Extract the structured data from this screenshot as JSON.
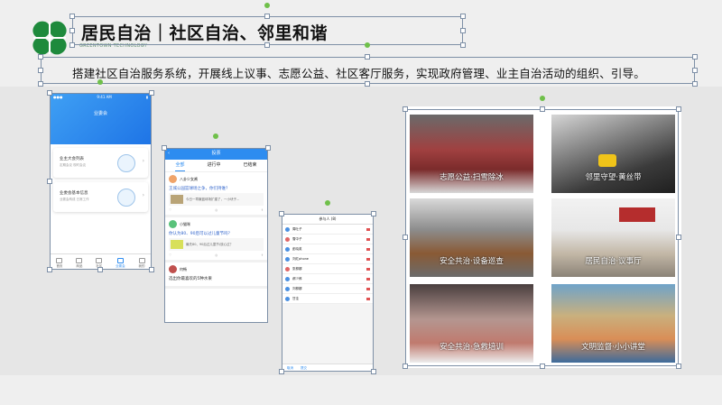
{
  "header": {
    "title": "居民自治｜社区自治、邻里和谐",
    "subtitle": "搭建社区自治服务系统，开展线上议事、志愿公益、社区客厅服务，实现政府管理、业主自治活动的组织、引导。",
    "logo_text": "GREENTOWN TECHNOLOGY",
    "brand_color": "#1e8a3c"
  },
  "phone1": {
    "status_time": "9:41 AM",
    "title": "业委会",
    "cards": [
      {
        "title": "业主大会列表",
        "desc": "定期会议 现时会议"
      },
      {
        "title": "业委会基本信息",
        "desc": "业委会构成 日常工作"
      }
    ],
    "tabs": [
      "首页",
      "商品",
      "社区",
      "业委会",
      "我的"
    ]
  },
  "phone2": {
    "title": "投票",
    "tabs": [
      "全部",
      "进行中",
      "已结束"
    ],
    "posts": [
      {
        "user": "八卦少女酱",
        "text": "王城公园篮球场之争，你们持谁？",
        "snippet": "今日一章篇篮球场扩建了，一小块子..."
      },
      {
        "user": "小猫咪",
        "text": "你认为80、90后可以过儿童节吗？",
        "snippet": "最先80、90后过儿童节/放心过？"
      },
      {
        "user": "何畅",
        "text": "选出你最喜欢的5种水果"
      }
    ]
  },
  "phone3": {
    "title": "参与人 (8)",
    "rows": [
      "周吐子",
      "雪中子",
      "彭晓英",
      "刘红phone",
      "张柳娜",
      "郝少郎",
      "刘柳娜",
      "甘洼"
    ],
    "bottom": [
      "取消",
      "提交"
    ]
  },
  "gallery": {
    "tiles": [
      {
        "caption": "志愿公益·扫雪除冰"
      },
      {
        "caption": "邻里守望·黄丝带"
      },
      {
        "caption": "安全共治·设备巡查"
      },
      {
        "caption": "居民自治·议事厅"
      },
      {
        "caption": "安全共治·急救培训"
      },
      {
        "caption": "文明监督·小小讲堂"
      }
    ]
  }
}
